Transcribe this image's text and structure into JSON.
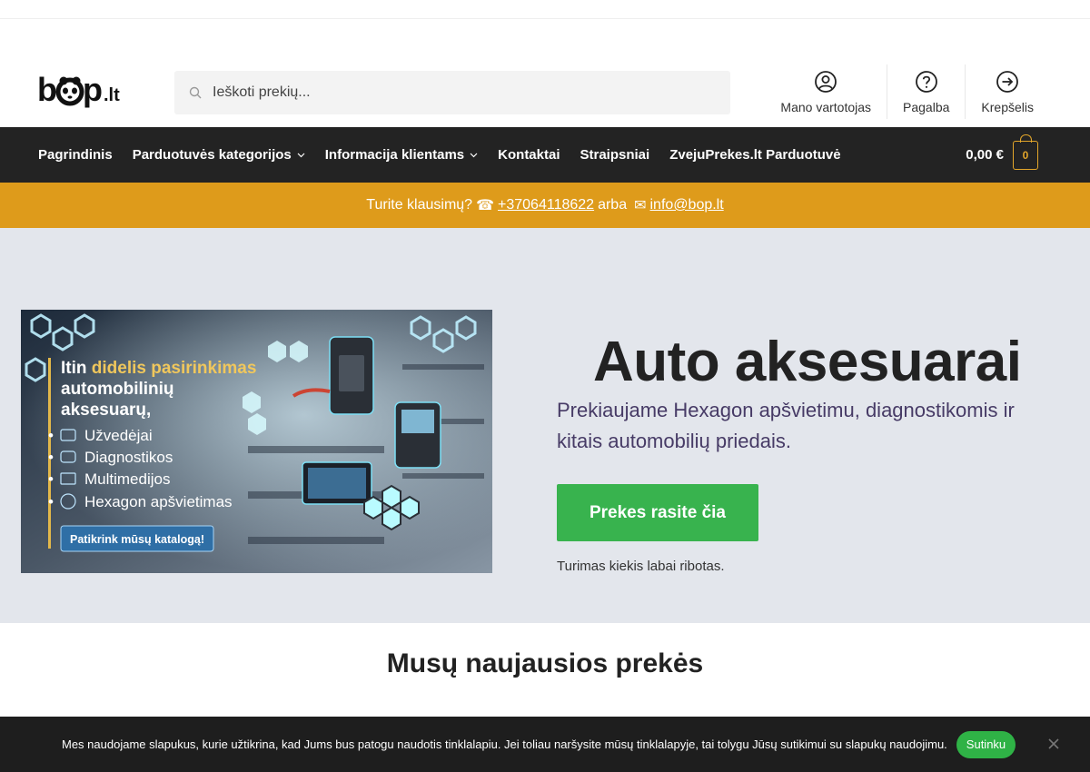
{
  "header": {
    "logo_text": "bop.lt",
    "search_placeholder": "Ieškoti prekių...",
    "icons": [
      {
        "label": "Mano vartotojas",
        "icon": "user-icon"
      },
      {
        "label": "Pagalba",
        "icon": "help-icon"
      },
      {
        "label": "Krepšelis",
        "icon": "arrow-right-icon"
      }
    ]
  },
  "nav": {
    "items": [
      {
        "label": "Pagrindinis",
        "dropdown": false
      },
      {
        "label": "Parduotuvės kategorijos",
        "dropdown": true
      },
      {
        "label": "Informacija klientams",
        "dropdown": true
      },
      {
        "label": "Kontaktai",
        "dropdown": false
      },
      {
        "label": "Straipsniai",
        "dropdown": false
      },
      {
        "label": "ZvejuPrekes.lt Parduotuvė",
        "dropdown": false
      }
    ],
    "cart_total": "0,00 €",
    "cart_count": "0"
  },
  "notice": {
    "text": "Turite klausimų?",
    "phone_glyph": "☎",
    "phone": "+37064118622",
    "or": "arba",
    "mail_glyph": "✉",
    "email": "info@bop.lt"
  },
  "hero": {
    "banner": {
      "headline_prefix": "Itin",
      "headline_highlight": "didelis pasirinkimas",
      "headline_line2": "automobilinių",
      "headline_line3": "aksesuarų,",
      "list": [
        "Užvedėjai",
        "Diagnostikos",
        "Multimedijos",
        "Hexagon apšvietimas"
      ],
      "button": "Patikrink mūsų katalogą!"
    },
    "title": "Auto aksesuarai",
    "subtitle": "Prekiaujame Hexagon apšvietimu, diagnostikomis ir kitais automobilių priedais.",
    "cta": "Prekes rasite čia",
    "note": "Turimas kiekis labai ribotas."
  },
  "section": {
    "title": "Musų naujausios prekės"
  },
  "cookie": {
    "text": "Mes naudojame slapukus, kurie užtikrina, kad Jums bus patogu naudotis tinklalapiu. Jei toliau naršysite mūsų tinklalapyje, tai tolygu Jūsų sutikimui su slapukų naudojimu.",
    "accept": "Sutinku"
  },
  "colors": {
    "nav_bg": "#232323",
    "notice_bg": "#de9b1b",
    "hero_bg": "#e3e6ec",
    "cta_bg": "#38b34e",
    "accent": "#e3a62a"
  }
}
